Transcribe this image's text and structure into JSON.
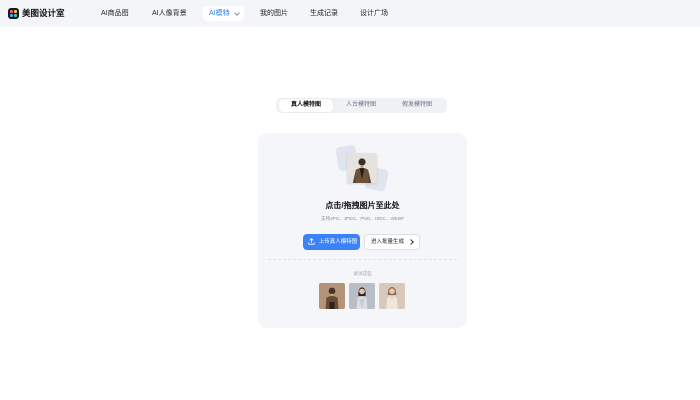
{
  "header": {
    "brand": "美图设计室",
    "nav": [
      {
        "label": "AI商品图"
      },
      {
        "label": "AI人像背景"
      },
      {
        "label": "AI模特",
        "active": true,
        "icon": "chevron-down-icon"
      },
      {
        "label": "我的图片"
      },
      {
        "label": "生成记录"
      },
      {
        "label": "设计广场"
      }
    ]
  },
  "tabs": [
    {
      "label": "真人模特图",
      "active": true
    },
    {
      "label": "人台模特图",
      "active": false
    },
    {
      "label": "假发模特图",
      "active": false
    }
  ],
  "upload": {
    "title": "点击/拖拽图片至此处",
    "formats": "支持JPG、JPEG、PNG、HEIC、WEBP",
    "primary_button": "上传真人模特图",
    "secondary_button": "进入批量生成",
    "try_label": "试试这些",
    "samples": [
      {
        "icon": "sample-model-photo-1"
      },
      {
        "icon": "sample-model-photo-2"
      },
      {
        "icon": "sample-model-photo-3"
      }
    ]
  },
  "colors": {
    "accent": "#3b82f6",
    "nav_bg": "#f4f5f8",
    "card_bg": "#f5f6f9"
  }
}
